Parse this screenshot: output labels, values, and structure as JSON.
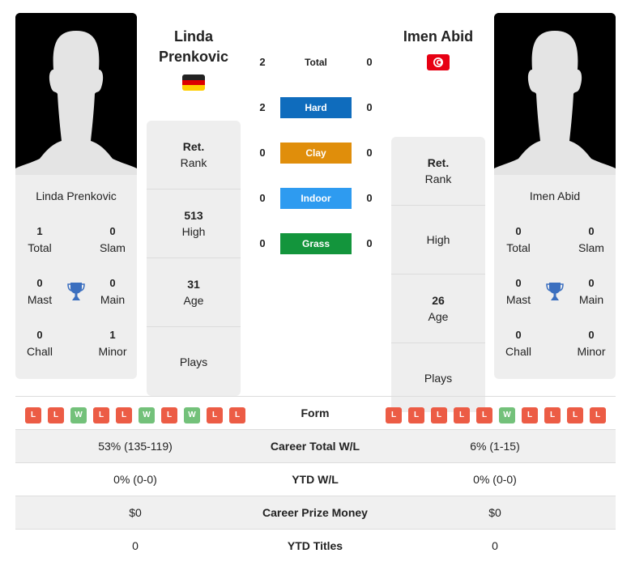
{
  "player1": {
    "name": "Linda Prenkovic",
    "name_line1": "Linda",
    "name_line2": "Prenkovic",
    "country": "Germany",
    "flag_icon": "germany-flag-icon",
    "card_name": "Linda Prenkovic",
    "titles": {
      "total": {
        "value": "1",
        "label": "Total"
      },
      "slam": {
        "value": "0",
        "label": "Slam"
      },
      "mast": {
        "value": "0",
        "label": "Mast"
      },
      "main": {
        "value": "0",
        "label": "Main"
      },
      "chall": {
        "value": "0",
        "label": "Chall"
      },
      "minor": {
        "value": "1",
        "label": "Minor"
      }
    },
    "info": {
      "rank": {
        "value": "Ret.",
        "label": "Rank"
      },
      "high": {
        "value": "513",
        "label": "High"
      },
      "age": {
        "value": "31",
        "label": "Age"
      },
      "plays": {
        "value": "",
        "label": "Plays"
      }
    },
    "form": [
      "L",
      "L",
      "W",
      "L",
      "L",
      "W",
      "L",
      "W",
      "L",
      "L"
    ]
  },
  "player2": {
    "name": "Imen Abid",
    "country": "Tunisia",
    "flag_icon": "tunisia-flag-icon",
    "card_name": "Imen Abid",
    "titles": {
      "total": {
        "value": "0",
        "label": "Total"
      },
      "slam": {
        "value": "0",
        "label": "Slam"
      },
      "mast": {
        "value": "0",
        "label": "Mast"
      },
      "main": {
        "value": "0",
        "label": "Main"
      },
      "chall": {
        "value": "0",
        "label": "Chall"
      },
      "minor": {
        "value": "0",
        "label": "Minor"
      }
    },
    "info": {
      "rank": {
        "value": "Ret.",
        "label": "Rank"
      },
      "high": {
        "value": "",
        "label": "High"
      },
      "age": {
        "value": "26",
        "label": "Age"
      },
      "plays": {
        "value": "",
        "label": "Plays"
      }
    },
    "form": [
      "L",
      "L",
      "L",
      "L",
      "L",
      "W",
      "L",
      "L",
      "L",
      "L"
    ]
  },
  "h2h": [
    {
      "label": "Total",
      "p1": "2",
      "p2": "0",
      "color": ""
    },
    {
      "label": "Hard",
      "p1": "2",
      "p2": "0",
      "color": "#0f6cbd"
    },
    {
      "label": "Clay",
      "p1": "0",
      "p2": "0",
      "color": "#e08e0b"
    },
    {
      "label": "Indoor",
      "p1": "0",
      "p2": "0",
      "color": "#2e9bf0"
    },
    {
      "label": "Grass",
      "p1": "0",
      "p2": "0",
      "color": "#13953c"
    }
  ],
  "colors": {
    "win": "#73c17a",
    "loss": "#ec5c45",
    "trophy": "#3b6fbf",
    "card_bg": "#eeeeee"
  },
  "stats": [
    {
      "label": "Form",
      "p1": "",
      "p2": ""
    },
    {
      "label": "Career Total W/L",
      "p1": "53% (135-119)",
      "p2": "6% (1-15)"
    },
    {
      "label": "YTD W/L",
      "p1": "0% (0-0)",
      "p2": "0% (0-0)"
    },
    {
      "label": "Career Prize Money",
      "p1": "$0",
      "p2": "$0"
    },
    {
      "label": "YTD Titles",
      "p1": "0",
      "p2": "0"
    }
  ]
}
